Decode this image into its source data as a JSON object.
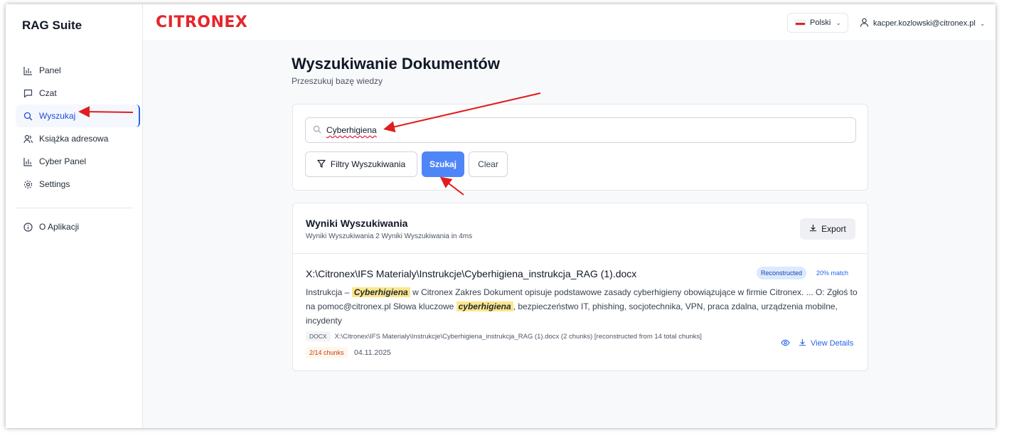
{
  "sidebar": {
    "app_title": "RAG Suite",
    "items": [
      {
        "label": "Panel",
        "icon": "bar-chart-icon"
      },
      {
        "label": "Czat",
        "icon": "chat-icon"
      },
      {
        "label": "Wyszukaj",
        "icon": "search-icon",
        "active": true
      },
      {
        "label": "Książka adresowa",
        "icon": "users-icon"
      },
      {
        "label": "Cyber Panel",
        "icon": "bar-chart-icon"
      },
      {
        "label": "Settings",
        "icon": "gear-icon"
      }
    ],
    "about": "O Aplikacji"
  },
  "header": {
    "logo": "CITRONEX",
    "language": "Polski",
    "user_email": "kacper.kozlowski@citronex.pl"
  },
  "page": {
    "title": "Wyszukiwanie Dokumentów",
    "subtitle": "Przeszukuj bazę wiedzy"
  },
  "search": {
    "value": "Cyberhigiena",
    "filters_label": "Filtry Wyszukiwania",
    "search_label": "Szukaj",
    "clear_label": "Clear"
  },
  "results": {
    "title": "Wyniki Wyszukiwania",
    "summary": "Wyniki Wyszukiwania 2 Wyniki Wyszukiwania in 4ms",
    "export_label": "Export",
    "items": [
      {
        "title": "X:\\Citronex\\IFS Materialy\\Instrukcje\\Cyberhigiena_instrukcja_RAG (1).docx",
        "badge": "Reconstructed",
        "match": "20% match",
        "snippet_1": "Instrukcja –",
        "highlight_1": "Cyberhigiena",
        "snippet_2": "w Citronex Zakres Dokument opisuje podstawowe zasady cyberhigieny obowiązujące w firmie Citronex. ... O: Zgłoś to na pomoc@citronex.pl Słowa kluczowe",
        "highlight_2": "cyberhigiena",
        "snippet_3": ", bezpieczeństwo IT, phishing, socjotechnika, VPN, praca zdalna, urządzenia mobilne, incydenty",
        "file_type": "DOCX",
        "meta": "X:\\Citronex\\IFS Materialy\\Instrukcje\\Cyberhigiena_instrukcja_RAG (1).docx (2 chunks) [reconstructed from 14 total chunks]",
        "chunks": "2/14 chunks",
        "date": "04.11.2025",
        "view_details_label": "View Details"
      }
    ]
  },
  "colors": {
    "accent": "#4f86f7",
    "logo": "#e4262b",
    "annotation_arrow": "#e11d1d",
    "highlight": "#fde68a"
  }
}
